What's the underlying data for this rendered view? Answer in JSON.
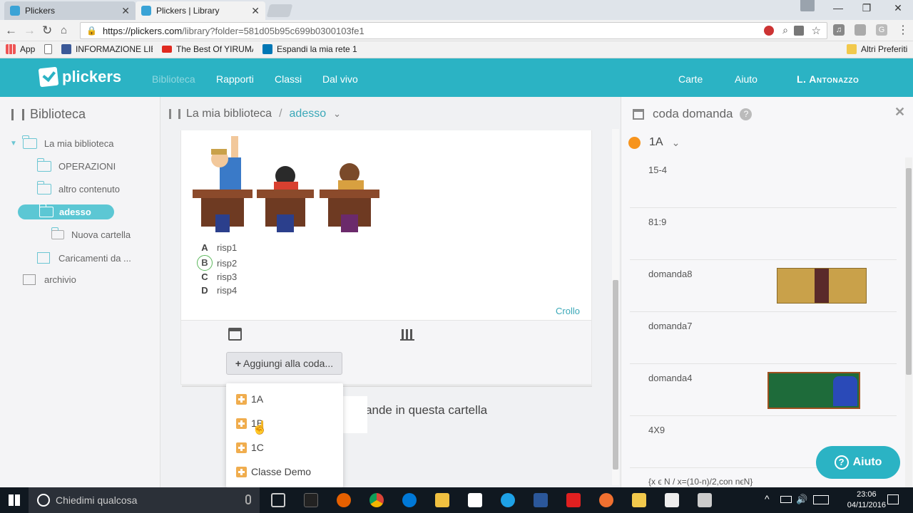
{
  "browser": {
    "tabs": [
      {
        "title": "Plickers",
        "close": "✕"
      },
      {
        "title": "Plickers | Library",
        "close": "✕"
      }
    ],
    "url_host": "https://plickers.com",
    "url_path": "/library?folder=581d05b95c699b0300103fe1",
    "bookmarks": [
      {
        "label": "App",
        "icon": "apps-grid-icon"
      },
      {
        "label": "INFORMAZIONE LIBE",
        "icon": "facebook-icon"
      },
      {
        "label": "The Best Of YIRUMA |",
        "icon": "youtube-icon"
      },
      {
        "label": "Espandi la mia rete 1",
        "icon": "linkedin-icon"
      }
    ],
    "other_bookmarks": "Altri Preferiti"
  },
  "app": {
    "logo": "plickers",
    "nav": [
      "Biblioteca",
      "Rapporti",
      "Classi",
      "Dal vivo"
    ],
    "nav_right": [
      "Carte",
      "Aiuto",
      "L. Antonazzo"
    ],
    "accent": "#2bb3c4"
  },
  "sidebar": {
    "title": "Biblioteca",
    "items": [
      {
        "label": "La mia biblioteca"
      },
      {
        "label": "OPERAZIONI"
      },
      {
        "label": "altro contenuto"
      },
      {
        "label": "adesso"
      },
      {
        "label": "Nuova cartella"
      },
      {
        "label": "Caricamenti da ..."
      },
      {
        "label": "archivio"
      }
    ]
  },
  "main": {
    "breadcrumb_root": "La mia biblioteca",
    "breadcrumb_sep": "/",
    "breadcrumb_current": "adesso",
    "answers": [
      {
        "letter": "A",
        "text": "risp1"
      },
      {
        "letter": "B",
        "text": "risp2",
        "correct": true
      },
      {
        "letter": "C",
        "text": "risp3"
      },
      {
        "letter": "D",
        "text": "risp4"
      }
    ],
    "crollo": "Crollo",
    "add_queue": "Aggiungi alla coda...",
    "message": "domande in questa cartella",
    "dropdown": [
      "1A",
      "1B",
      "1C",
      "Classe Demo"
    ]
  },
  "queue": {
    "title": "coda domanda",
    "class_name": "1A",
    "items": [
      "15-4",
      "81:9",
      "domanda8",
      "domanda7",
      "domanda4",
      "4X9",
      "{x ϵ N / x=(10-n)/2,con nϵN}"
    ],
    "help_button": "Aiuto"
  },
  "taskbar": {
    "search_placeholder": "Chiedimi qualcosa",
    "time": "23:06",
    "date": "04/11/2016"
  }
}
